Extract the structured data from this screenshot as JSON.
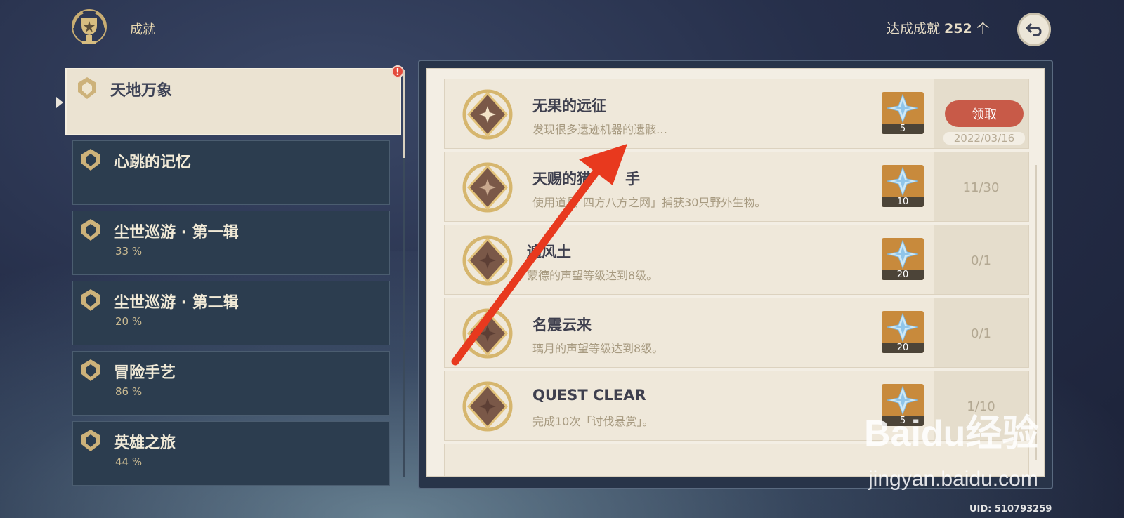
{
  "header": {
    "title": "成就",
    "count_label": "达成成就",
    "count_value": "252",
    "count_unit": "个"
  },
  "sidebar": {
    "items": [
      {
        "label": "天地万象",
        "pct": "",
        "active": true
      },
      {
        "label": "心跳的记忆",
        "pct": ""
      },
      {
        "label": "尘世巡游 · 第一辑",
        "pct": "33 %"
      },
      {
        "label": "尘世巡游 · 第二辑",
        "pct": "20 %"
      },
      {
        "label": "冒险手艺",
        "pct": "86 %"
      },
      {
        "label": "英雄之旅",
        "pct": "44 %"
      }
    ],
    "notification": "!"
  },
  "achievements": [
    {
      "title": "无果的远征",
      "desc": "发现很多遗迹机器的遗骸…",
      "reward": "5",
      "status": "claim",
      "claim_label": "领取",
      "date": "2022/03/16"
    },
    {
      "title": "天赐的猎",
      "title_tail": "手",
      "desc": "使用道具",
      "desc_tail": "四方八方之网」捕获30只野外生物。",
      "reward": "10",
      "progress": "11/30"
    },
    {
      "title": "",
      "title_tail": "遍风土",
      "desc": "",
      "desc_tail": "蒙德的声望等级达到8级。",
      "reward": "20",
      "progress": "0/1"
    },
    {
      "title": "名震云来",
      "desc": "璃月的声望等级达到8级。",
      "reward": "20",
      "progress": "0/1"
    },
    {
      "title": "QUEST CLEAR",
      "desc": "完成10次「讨伐悬赏」。",
      "reward": "5",
      "progress": "1/10"
    }
  ],
  "watermark": {
    "logo": "Baidu经验",
    "url": "jingyan.baidu.com"
  },
  "uid": "UID: 510793259",
  "colors": {
    "claim_button": "#c85a48",
    "reward_bg": "#c88a3c",
    "arrow": "#e8391e"
  }
}
